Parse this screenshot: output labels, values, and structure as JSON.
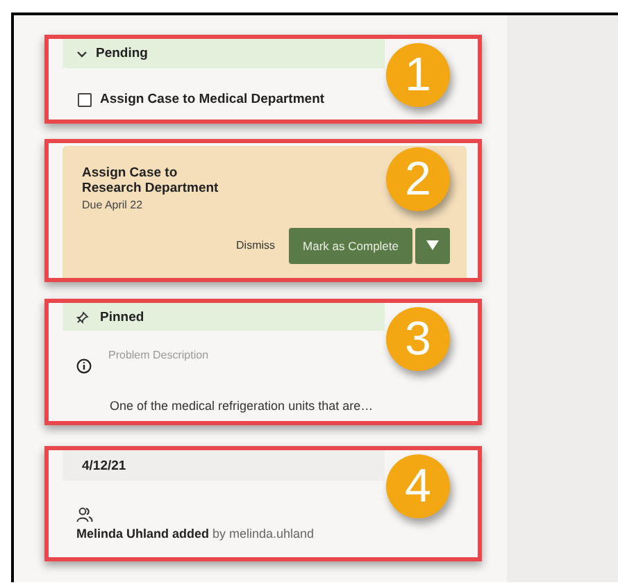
{
  "sections": [
    {
      "kind": "group",
      "callout": "1",
      "header": {
        "label": "Pending",
        "expanded": true
      },
      "task": {
        "label": "Assign Case to Medical Department",
        "checked": false
      }
    },
    {
      "kind": "task_card",
      "callout": "2",
      "title": "Assign Case to Research Department",
      "due": "Due April 22",
      "dismiss": "Dismiss",
      "primary": "Mark as Complete"
    },
    {
      "kind": "pinned",
      "callout": "3",
      "header": "Pinned",
      "field_label": "Problem Description",
      "field_value": "One of the medical refrigeration units that are…"
    },
    {
      "kind": "activity",
      "callout": "4",
      "date": "4/12/21",
      "entry": "**Melinda Uhland added** by melinda.uhland"
    }
  ]
}
